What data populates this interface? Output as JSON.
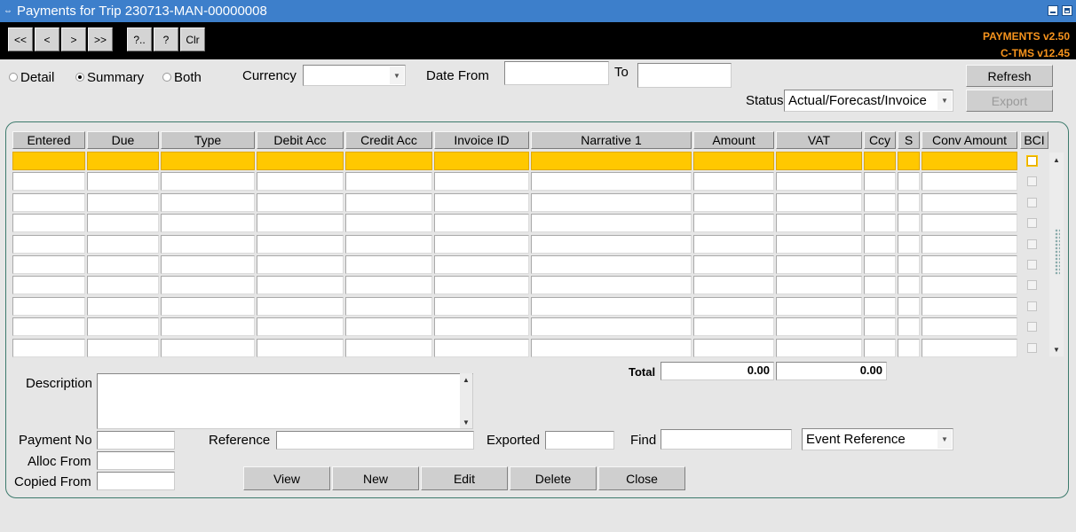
{
  "window": {
    "title": "Payments for Trip 230713-MAN-00000008"
  },
  "toolbar": {
    "buttons": {
      "first": "<<",
      "prev": "<",
      "next": ">",
      "last": ">>",
      "query": "?..",
      "help": "?",
      "clear": "Clr"
    },
    "version_line1": "PAYMENTS v2.50",
    "version_line2": "C-TMS v12.45"
  },
  "view_mode": {
    "detail": "Detail",
    "summary": "Summary",
    "both": "Both",
    "selected": "Summary"
  },
  "filters": {
    "currency_label": "Currency",
    "currency_value": "",
    "date_from_label": "Date From",
    "date_from_value": "",
    "to_label": "To",
    "to_value": "",
    "status_label": "Status",
    "status_value": "Actual/Forecast/Invoice"
  },
  "actions": {
    "refresh": "Refresh",
    "export": "Export"
  },
  "table": {
    "columns": [
      "Entered",
      "Due",
      "Type",
      "Debit Acc",
      "Credit Acc",
      "Invoice ID",
      "Narrative 1",
      "Amount",
      "VAT",
      "Ccy",
      "S",
      "Conv Amount",
      "BCI"
    ],
    "row_count": 10,
    "selected_row": 0
  },
  "totals": {
    "label": "Total",
    "amount": "0.00",
    "vat": "0.00"
  },
  "details": {
    "description_label": "Description",
    "description_value": "",
    "payment_no_label": "Payment No",
    "alloc_from_label": "Alloc From",
    "copied_from_label": "Copied From",
    "reference_label": "Reference",
    "exported_label": "Exported",
    "find_label": "Find",
    "find_value": "",
    "find_by_value": "Event Reference"
  },
  "bottom_buttons": {
    "view": "View",
    "new": "New",
    "edit": "Edit",
    "delete": "Delete",
    "close": "Close"
  },
  "colors": {
    "titlebar": "#3d7fcb",
    "selected_row": "#ffc800",
    "version_text": "#f7941d",
    "panel_border": "#3c7a6c"
  }
}
